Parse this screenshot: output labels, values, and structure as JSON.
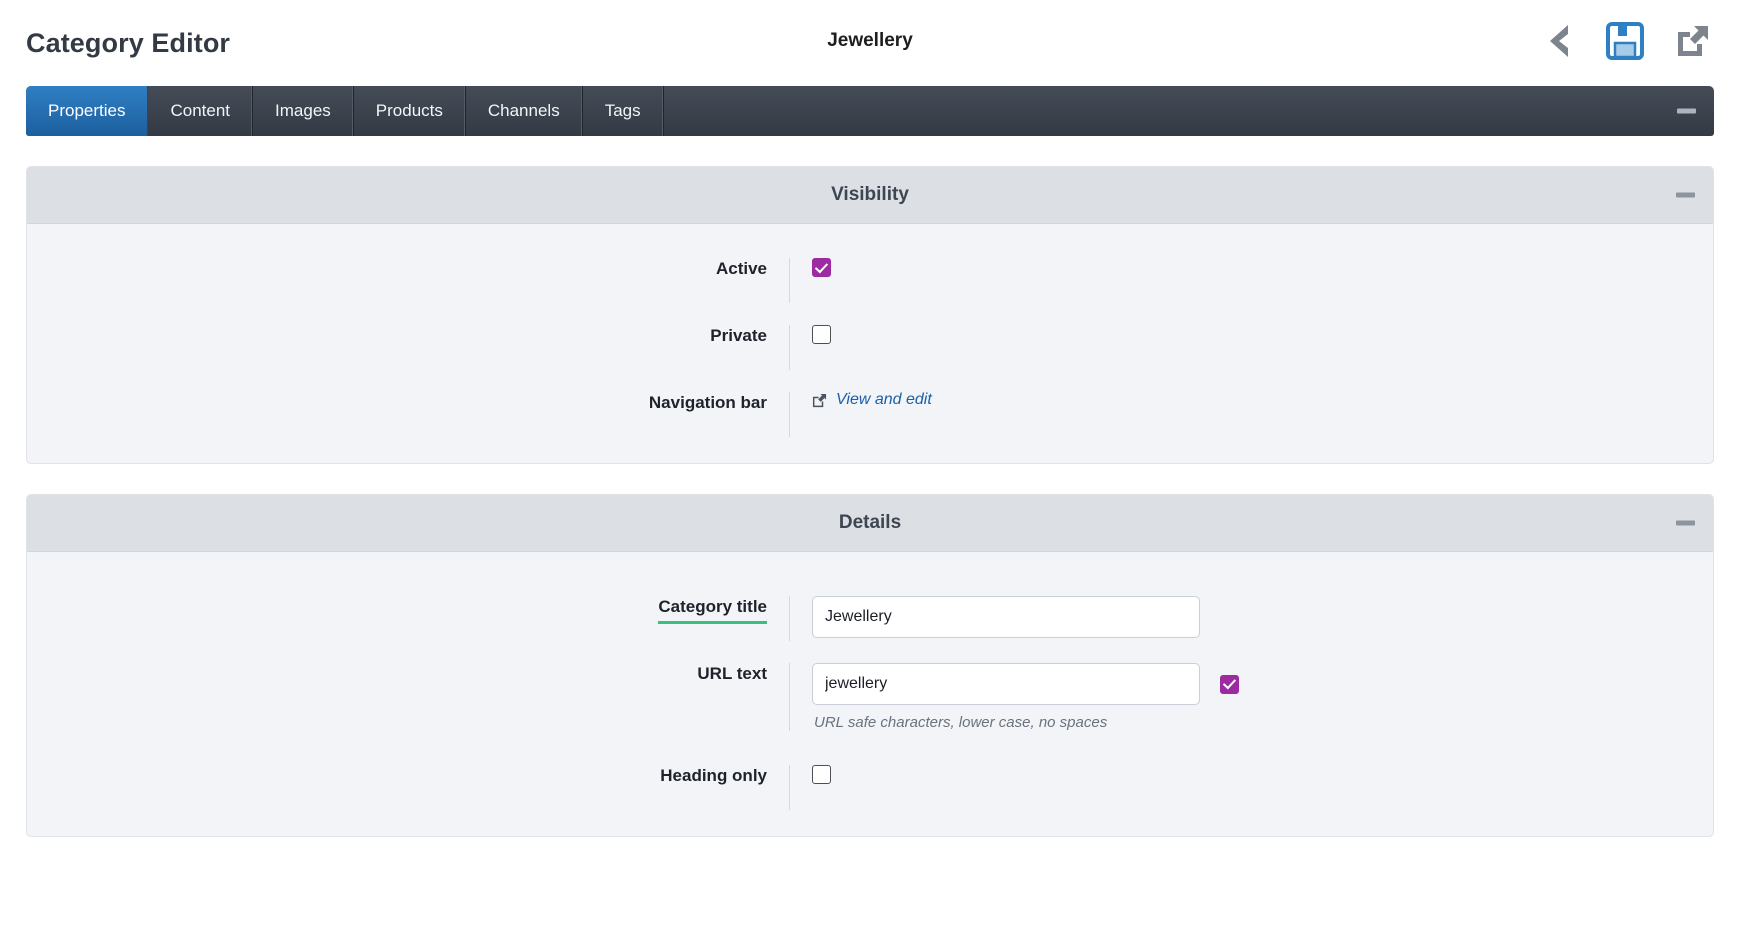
{
  "header": {
    "page_title": "Category Editor",
    "record_title": "Jewellery",
    "actions": [
      {
        "name": "back",
        "icon": "back-chevron-icon",
        "color": "#7d848d"
      },
      {
        "name": "save",
        "icon": "floppy-disk-save-icon",
        "color": "#2f7fc4"
      },
      {
        "name": "open-external",
        "icon": "external-link-icon",
        "color": "#7d848d"
      }
    ]
  },
  "tabs": [
    {
      "label": "Properties",
      "active": true
    },
    {
      "label": "Content",
      "active": false
    },
    {
      "label": "Images",
      "active": false
    },
    {
      "label": "Products",
      "active": false
    },
    {
      "label": "Channels",
      "active": false
    },
    {
      "label": "Tags",
      "active": false
    }
  ],
  "panels": {
    "visibility": {
      "title": "Visibility",
      "collapse_label": "−",
      "rows": {
        "active": {
          "label": "Active",
          "checked": true
        },
        "private": {
          "label": "Private",
          "checked": false
        },
        "navigation_bar": {
          "label": "Navigation bar",
          "link_text": "View and edit",
          "link_icon": "external-link-icon"
        }
      }
    },
    "details": {
      "title": "Details",
      "collapse_label": "−",
      "rows": {
        "category_title": {
          "label": "Category title",
          "required": true,
          "value": "Jewellery",
          "placeholder": ""
        },
        "url_text": {
          "label": "URL text",
          "value": "jewellery",
          "placeholder": "",
          "helper": "URL safe characters, lower case, no spaces",
          "checkbox_checked": true
        },
        "heading_only": {
          "label": "Heading only",
          "checked": false
        }
      }
    }
  },
  "colors": {
    "accent_blue": "#2f7fc4",
    "checkbox_purple": "#9c2aa0",
    "required_green": "#36c17d",
    "tabbar_dark": "#333a44",
    "panel_header": "#dcdfe4",
    "panel_body": "#f2f4f7"
  }
}
